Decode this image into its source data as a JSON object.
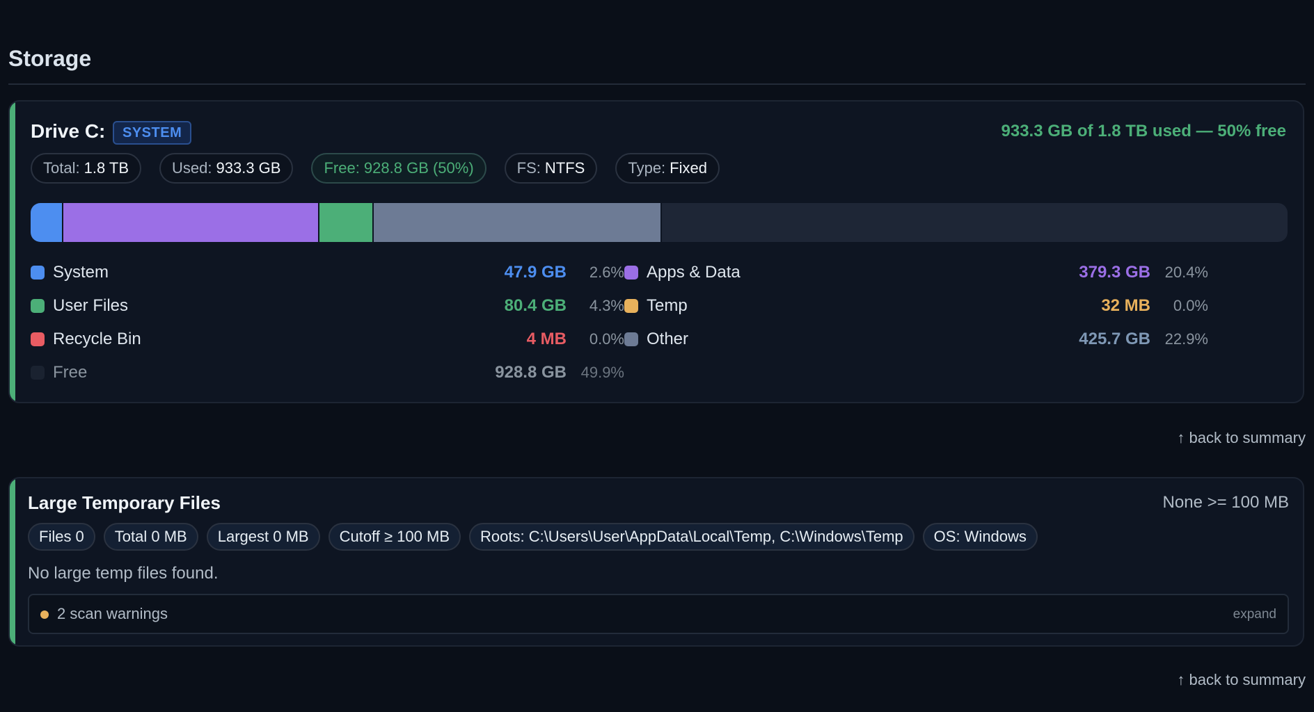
{
  "storage": {
    "title": "Storage"
  },
  "drive": {
    "title": "Drive C:",
    "badge": "SYSTEM",
    "summary": "933.3 GB of 1.8 TB used — 50% free",
    "chips": {
      "total_label": "Total:",
      "total_value": "1.8 TB",
      "used_label": "Used:",
      "used_value": "933.3 GB",
      "free_text": "Free: 928.8 GB (50%)",
      "fs_label": "FS:",
      "fs_value": "NTFS",
      "type_label": "Type:",
      "type_value": "Fixed"
    },
    "usage_bar": [
      {
        "name": "System",
        "fraction": 0.026,
        "color": "#4d8ef0"
      },
      {
        "name": "Apps & Data",
        "fraction": 0.204,
        "color": "#9b6fe6"
      },
      {
        "name": "User Files",
        "fraction": 0.043,
        "color": "#4caf78"
      },
      {
        "name": "Other",
        "fraction": 0.229,
        "color": "#6d7b95"
      }
    ],
    "legend": {
      "system": {
        "label": "System",
        "value": "47.9 GB",
        "pct": "2.6%",
        "color": "#4d8ef0"
      },
      "apps": {
        "label": "Apps & Data",
        "value": "379.3 GB",
        "pct": "20.4%",
        "color": "#9b6fe6"
      },
      "user": {
        "label": "User Files",
        "value": "80.4 GB",
        "pct": "4.3%",
        "color": "#4caf78"
      },
      "temp": {
        "label": "Temp",
        "value": "32 MB",
        "pct": "0.0%",
        "color": "#e8b15c"
      },
      "recycle": {
        "label": "Recycle Bin",
        "value": "4 MB",
        "pct": "0.0%",
        "color": "#e85c63"
      },
      "other": {
        "label": "Other",
        "value": "425.7 GB",
        "pct": "22.9%",
        "color": "#6d7b95"
      },
      "free": {
        "label": "Free",
        "value": "928.8 GB",
        "pct": "49.9%",
        "color": "#1a2230"
      }
    }
  },
  "back_link_1": "↑ back to summary",
  "temp_files": {
    "title": "Large Temporary Files",
    "status": "None >= 100 MB",
    "chips": {
      "files": "Files 0",
      "total": "Total 0 MB",
      "largest": "Largest 0 MB",
      "cutoff": "Cutoff ≥ 100 MB",
      "roots": "Roots: C:\\Users\\User\\AppData\\Local\\Temp, C:\\Windows\\Temp",
      "os": "OS: Windows"
    },
    "empty_message": "No large temp files found.",
    "warnings": {
      "text": "2 scan warnings",
      "expand": "expand"
    }
  },
  "back_link_2": "↑ back to summary",
  "colors": {
    "accent_green": "#4caf78",
    "background": "#0a0f18"
  }
}
